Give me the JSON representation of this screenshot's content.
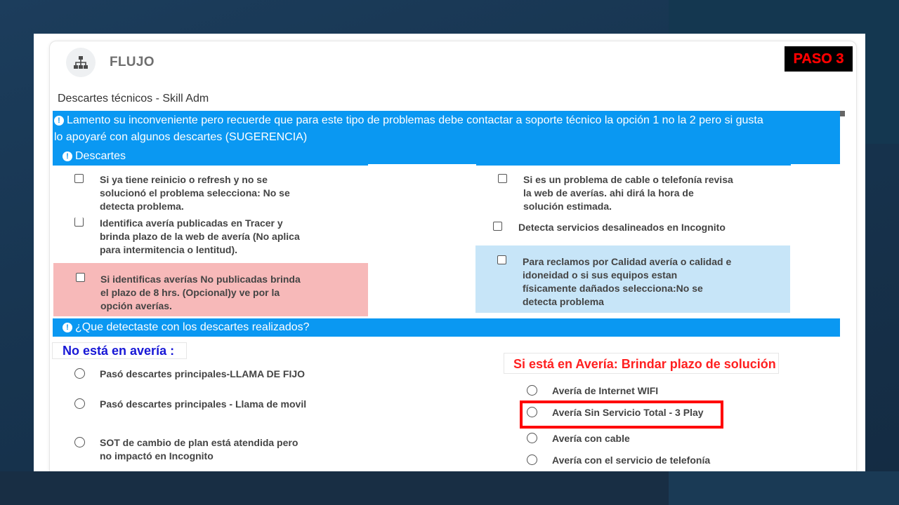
{
  "header": {
    "icon": "sitemap-icon",
    "title": "FLUJO",
    "step_badge": "PASO 3"
  },
  "subtitle": "Descartes técnicos - Skill Adm",
  "notice": {
    "line1": "Lamento su inconveniente pero recuerde que para este tipo de problemas debe contactar a soporte técnico la opción 1 no la 2 pero si gusta",
    "line2": "lo apoyaré con algunos descartes (SUGERENCIA)"
  },
  "descartes": {
    "title": "Descartes",
    "left": [
      {
        "lines": [
          "Si ya tiene reinicio o refresh y no se",
          "solucionó el problema selecciona: No se",
          "detecta problema."
        ]
      },
      {
        "lines": [
          "Identifica avería publicadas en Tracer y",
          "brinda plazo de la web de avería (No aplica",
          "para intermitencia o lentitud)."
        ]
      },
      {
        "lines": [
          "Si identificas averías No publicadas brinda",
          "el plazo de 8 hrs. (Opcional)y ve por la",
          "opción averías."
        ],
        "highlight": "#f7b9b9"
      }
    ],
    "right": [
      {
        "lines": [
          "Si es un problema de cable o telefonía revisa",
          "la web de averías. ahi dirá la hora de",
          "solución estimada."
        ]
      },
      {
        "lines": [
          "Detecta servicios desalineados en Incognito"
        ]
      },
      {
        "lines": [
          "Para reclamos por Calidad avería o calidad e",
          "idoneidad o si sus equipos estan",
          "físicamente dañados selecciona:No se",
          "detecta problema"
        ],
        "highlight": "#c7e5f8"
      }
    ]
  },
  "question": {
    "title": "¿Que detectaste con los descartes realizados?",
    "no_averia_label": "No está en avería :",
    "no_averia_options": [
      [
        "Pasó descartes principales-LLAMA DE FIJO"
      ],
      [
        "Pasó descartes principales - Llama de movil"
      ],
      [
        "SOT de cambio de plan está atendida pero",
        "no impactó en Incognito"
      ]
    ],
    "si_averia_label": "Si está en Avería: Brindar plazo de solución",
    "si_averia_options": [
      "Avería de Internet WIFI",
      "Avería Sin Servicio Total - 3 Play",
      "Avería con cable",
      "Avería con el servicio de telefonía"
    ],
    "highlighted_option": "Avería Sin Servicio Total - 3 Play"
  },
  "colors": {
    "section_bar": "#0a98f2",
    "badge_text": "#ff0000",
    "no_averia": "#1717d6",
    "si_averia": "#ff2020",
    "highlight_border": "#ff0000"
  }
}
